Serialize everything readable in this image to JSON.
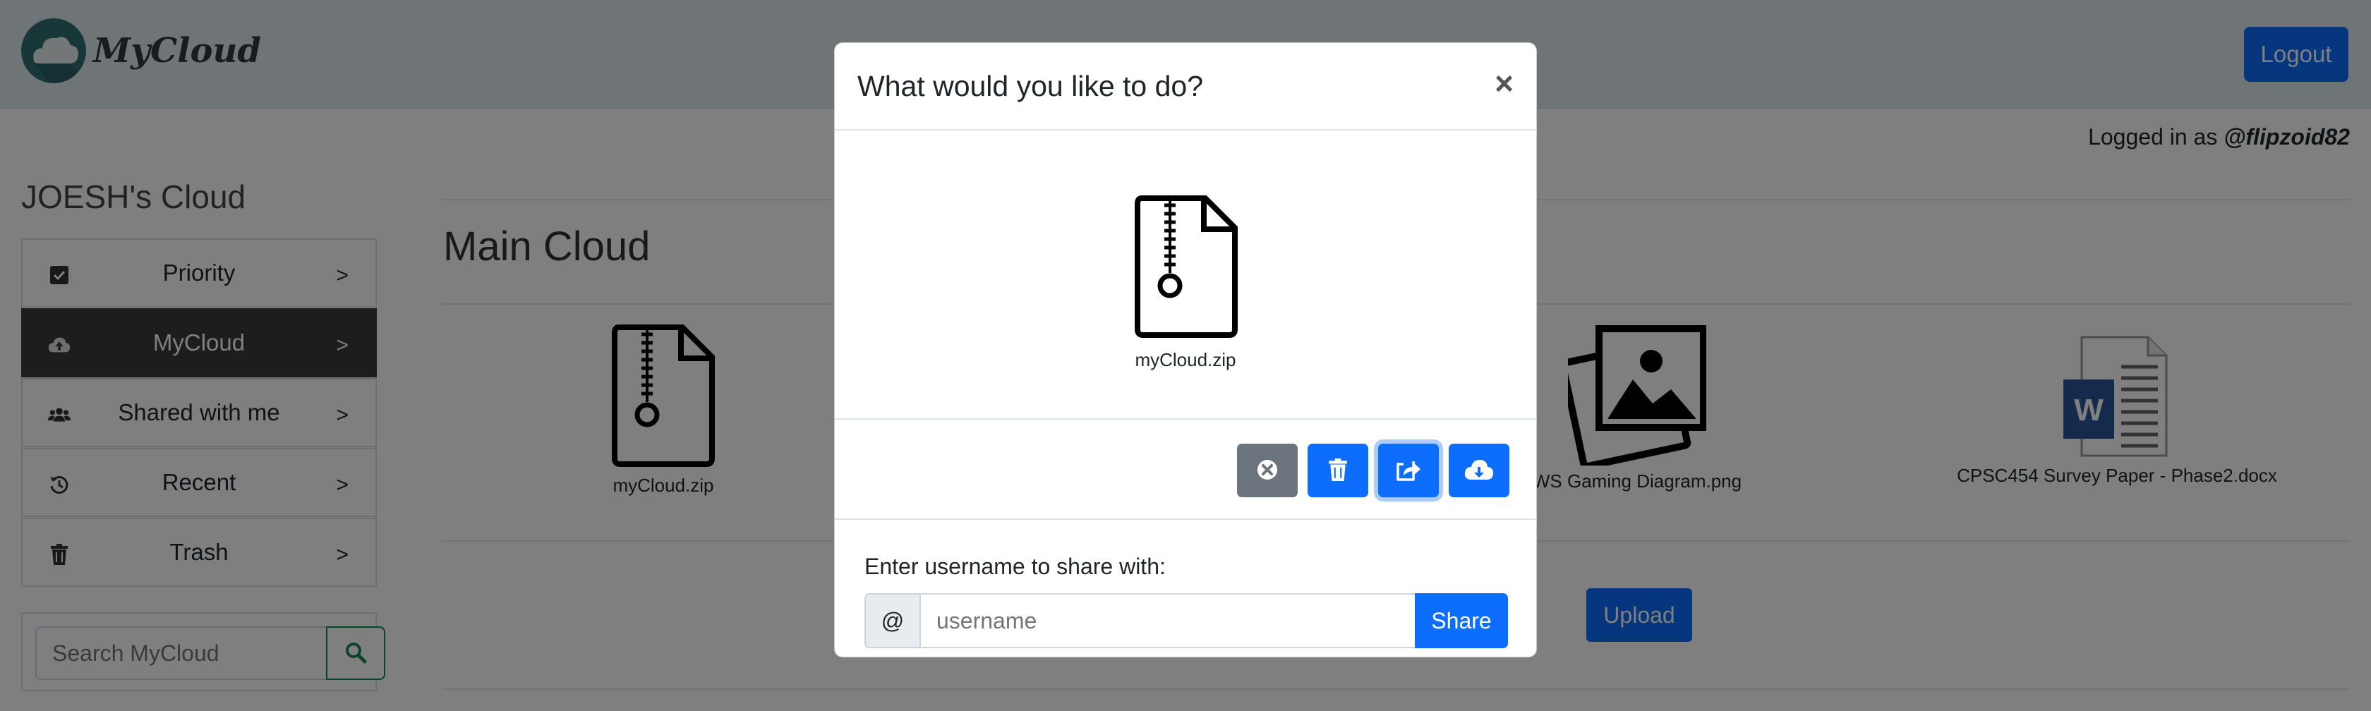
{
  "header": {
    "brand": "MyCloud",
    "logout_label": "Logout"
  },
  "session": {
    "logged_in_prefix": "Logged in as",
    "username": "@flipzoid82"
  },
  "sidebar": {
    "title": "JOESH's Cloud",
    "items": [
      {
        "label": "Priority",
        "icon": "checkbox-icon",
        "arrow": ">"
      },
      {
        "label": "MyCloud",
        "icon": "cloud-upload-icon",
        "arrow": ">",
        "active": true
      },
      {
        "label": "Shared with me",
        "icon": "users-icon",
        "arrow": ">"
      },
      {
        "label": "Recent",
        "icon": "history-icon",
        "arrow": ">"
      },
      {
        "label": "Trash",
        "icon": "trash-icon",
        "arrow": ">"
      }
    ],
    "search_placeholder": "Search MyCloud"
  },
  "main": {
    "title": "Main Cloud",
    "files": [
      {
        "name": "myCloud.zip",
        "icon": "zip-file-icon"
      },
      {
        "name": "WS Gaming Diagram.png",
        "icon": "image-file-icon"
      },
      {
        "name": "CPSC454 Survey Paper - Phase2.docx",
        "icon": "word-file-icon"
      }
    ],
    "upload_label": "Upload"
  },
  "modal": {
    "title": "What would you like to do?",
    "close_symbol": "×",
    "file_name": "myCloud.zip",
    "actions": [
      {
        "name": "close",
        "icon": "close-circle-icon",
        "color": "#6c757d"
      },
      {
        "name": "delete",
        "icon": "trash-icon",
        "color": "#0d6efd"
      },
      {
        "name": "share",
        "icon": "share-icon",
        "color": "#0d6efd",
        "focused": true
      },
      {
        "name": "download",
        "icon": "cloud-download-icon",
        "color": "#0d6efd"
      }
    ],
    "share_label": "Enter username to share with:",
    "share_prefix": "@",
    "share_placeholder": "username",
    "share_button": "Share"
  },
  "colors": {
    "primary": "#0d6efd",
    "secondary": "#6c757d",
    "success": "#198754",
    "navbar": "#dfe8ef",
    "sidebar_active": "#3a3a3a"
  }
}
